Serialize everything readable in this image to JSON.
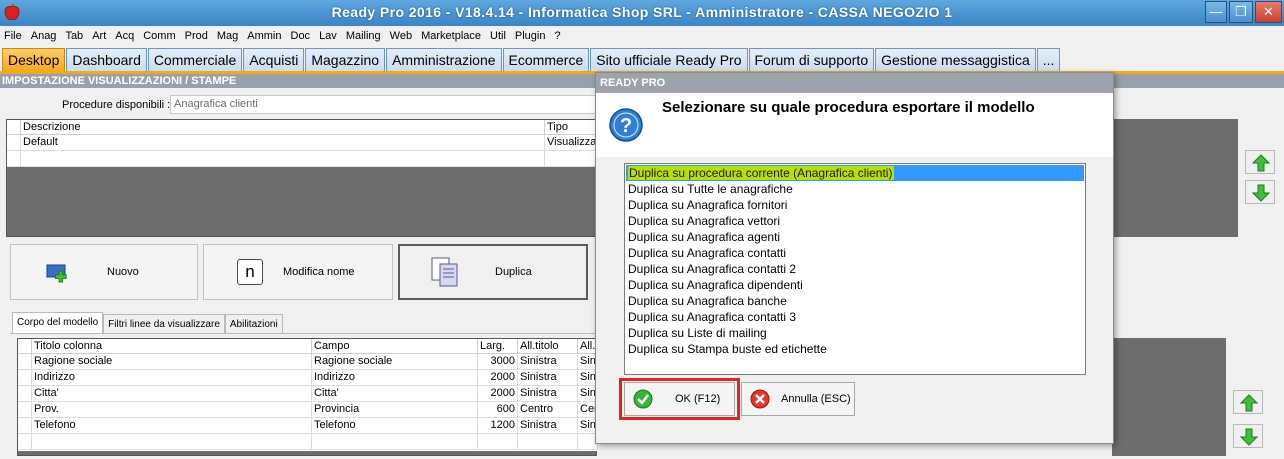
{
  "window": {
    "title": "Ready Pro 2016 - V18.4.14 - Informatica Shop SRL - Amministratore - CASSA NEGOZIO 1",
    "minimize_label": "—",
    "maximize_label": "❐",
    "close_label": "✕"
  },
  "menu": [
    "File",
    "Anag",
    "Tab",
    "Art",
    "Acq",
    "Comm",
    "Prod",
    "Mag",
    "Ammin",
    "Doc",
    "Lav",
    "Mailing",
    "Web",
    "Marketplace",
    "Util",
    "Plugin",
    "?"
  ],
  "tabs": [
    "Desktop",
    "Dashboard",
    "Commerciale",
    "Acquisti",
    "Magazzino",
    "Amministrazione",
    "Ecommerce",
    "Sito ufficiale Ready Pro",
    "Forum di supporto",
    "Gestione messaggistica",
    "..."
  ],
  "active_tab": "Desktop",
  "section": {
    "header": "IMPOSTAZIONE VISUALIZZAZIONI / STAMPE",
    "procedure_label": "Procedure disponibili :",
    "procedure_value": "Anagrafica clienti"
  },
  "models_grid": {
    "columns": [
      "Descrizione",
      "Tipo"
    ],
    "rows": [
      [
        "Default",
        "Visualizzazione"
      ]
    ]
  },
  "actions": {
    "new_label": "Nuovo",
    "rename_label": "Modifica nome",
    "rename_icon_char": "n",
    "duplicate_label": "Duplica"
  },
  "subtabs": [
    "Corpo del modello",
    "Filtri linee da visualizzare",
    "Abilitazioni"
  ],
  "columns_grid": {
    "columns": [
      "Titolo colonna",
      "Campo",
      "Larg.",
      "All.titolo",
      "All."
    ],
    "rows": [
      [
        "Ragione sociale",
        "Ragione sociale",
        "3000",
        "Sinistra",
        "Sinistra"
      ],
      [
        "Indirizzo",
        "Indirizzo",
        "2000",
        "Sinistra",
        "Sinistra"
      ],
      [
        "Citta'",
        "Citta'",
        "2000",
        "Sinistra",
        "Sinistra"
      ],
      [
        "Prov.",
        "Provincia",
        "600",
        "Centro",
        "Centro"
      ],
      [
        "Telefono",
        "Telefono",
        "1200",
        "Sinistra",
        "Sinistra"
      ]
    ]
  },
  "dialog": {
    "title": "READY PRO",
    "message": "Selezionare su quale procedura esportare il modello",
    "options": [
      "Duplica su procedura corrente (Anagrafica clienti)",
      "Duplica su Tutte le anagrafiche",
      "Duplica su Anagrafica fornitori",
      "Duplica su Anagrafica vettori",
      "Duplica su Anagrafica agenti",
      "Duplica su Anagrafica contatti",
      "Duplica su Anagrafica contatti 2",
      "Duplica su Anagrafica dipendenti",
      "Duplica su Anagrafica banche",
      "Duplica su Anagrafica contatti 3",
      "Duplica su Liste di mailing",
      "Duplica su Stampa buste ed etichette"
    ],
    "selected_index": 0,
    "ok_label": "OK (F12)",
    "cancel_label": "Annulla (ESC)"
  },
  "colors": {
    "titlebar": "#4a94d2",
    "active_tab": "#f4a81c",
    "selection": "#3399ff",
    "highlight": "#b7e000",
    "ok_outline": "#e02323",
    "grid_empty": "#6d6d6d"
  }
}
